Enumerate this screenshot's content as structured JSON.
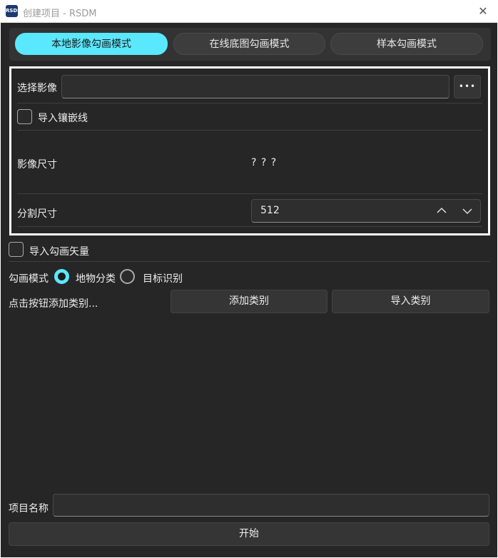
{
  "window": {
    "title": "创建项目 - RSDM",
    "logo_text": "RSDM"
  },
  "tabs": [
    {
      "label": "本地影像勾画模式",
      "active": true
    },
    {
      "label": "在线底图勾画模式",
      "active": false
    },
    {
      "label": "样本勾画模式",
      "active": false
    }
  ],
  "panel": {
    "select_image_label": "选择影像",
    "select_image_value": "",
    "browse_label": "•••",
    "import_mosaic_label": "导入镶嵌线",
    "import_mosaic_checked": false,
    "image_size_label": "影像尺寸",
    "image_size_value": "? ? ?",
    "split_size_label": "分割尺寸",
    "split_size_value": "512"
  },
  "import_vector": {
    "label": "导入勾画矢量",
    "checked": false
  },
  "draw_mode": {
    "label": "勾画模式",
    "options": [
      {
        "label": "地物分类",
        "selected": true
      },
      {
        "label": "目标识别",
        "selected": false
      }
    ]
  },
  "category": {
    "hint": "点击按钮添加类别...",
    "add_label": "添加类别",
    "import_label": "导入类别"
  },
  "project": {
    "name_label": "项目名称",
    "name_value": ""
  },
  "start_label": "开始",
  "colors": {
    "accent": "#5ae8ff",
    "background": "#262626",
    "panel_border": "#ffffff"
  }
}
